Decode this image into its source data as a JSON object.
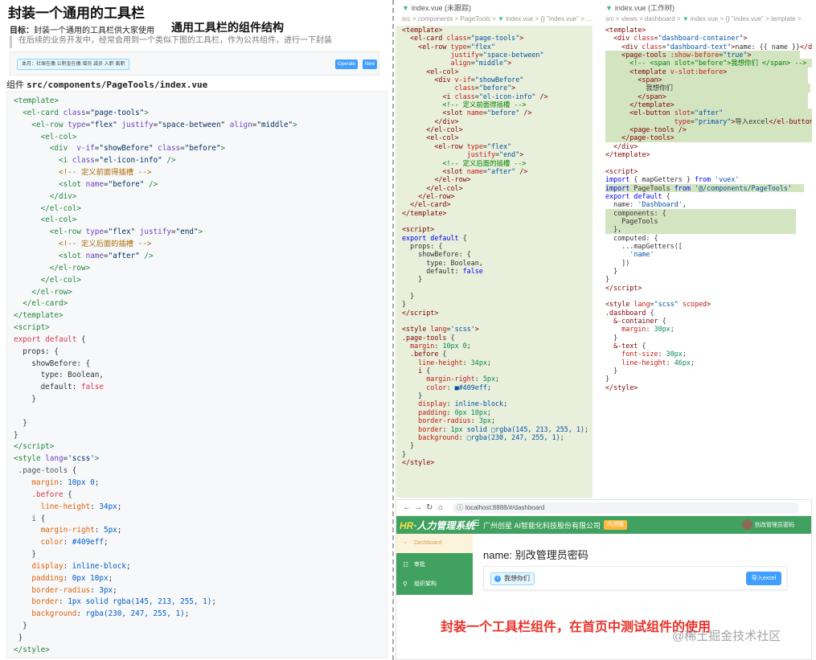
{
  "doc": {
    "title": "封装一个通用的工具栏",
    "goal_label": "目标：",
    "goal_text": "封装一个通用的工具栏供大家使用",
    "structure_title": "通用工具栏的组件结构",
    "quote": "在后续的业务开发中，经常会用到一个类似下图的工具栏，作为公共组件，进行一下封装",
    "preview": {
      "info_text": "本月：社保在缴 公积金在缴 增员 减员 入职 离职",
      "btn1": "Operate",
      "btn2": "New"
    },
    "file_label_prefix": "组件",
    "file_path": "src/components/PageTools/index.vue"
  },
  "editor1": {
    "tab": "index.vue (未跟踪)",
    "breadcrumb": "src > components > PageTools > ",
    "breadcrumb_tail": "index.vue > {} \"index.vue\" > ..."
  },
  "editor2": {
    "tab": "index.vue (工作树)",
    "breadcrumb": "src > views > dashboard > ",
    "breadcrumb_tail": "index.vue > {} \"index.vue\" > template >"
  },
  "browser": {
    "url": "localhost:8888/#/dashboard",
    "logo_hr": "HR",
    "logo_text": "·人力管理系统",
    "company": "广州创星 AI智能化科技股份有限公司",
    "badge": "内测版",
    "user": "别改管理员密码",
    "sidebar": [
      "Dashboard",
      "审批",
      "组织架构"
    ],
    "name_line": "name: 别改管理员密码",
    "before_text": "我想你们",
    "import_btn": "导入excel"
  },
  "caption": "封装一个工具栏组件，在首页中测试组件的使用",
  "watermark": "@稀土掘金技术社区",
  "colors": {
    "primary": "#409eff",
    "brand_green": "#40a160",
    "caption_red": "#e8342b"
  }
}
